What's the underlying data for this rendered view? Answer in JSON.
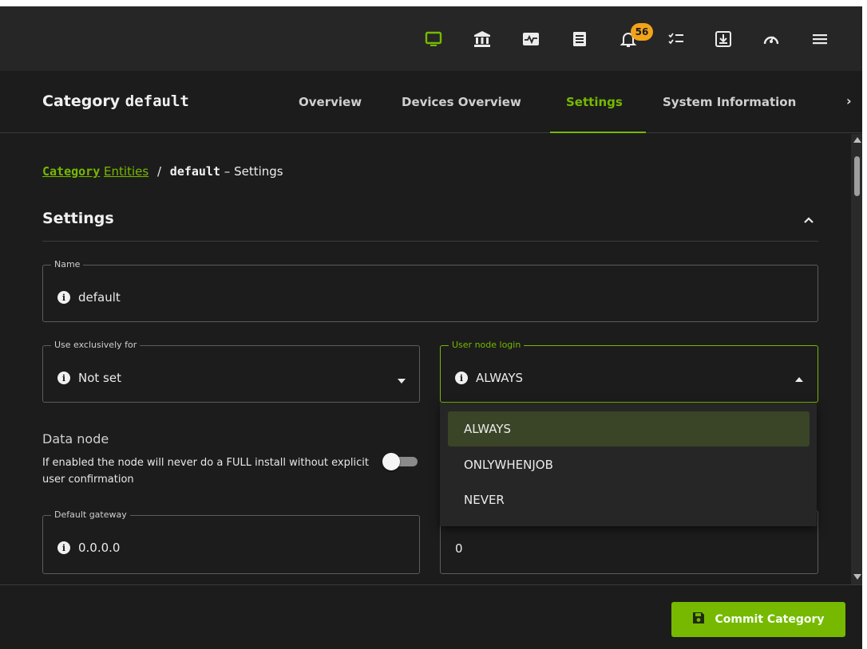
{
  "topbar": {
    "icons": [
      "monitor-icon",
      "bank-icon",
      "activity-icon",
      "document-icon",
      "bell-icon",
      "checklist-icon",
      "download-box-icon",
      "dashboard-icon",
      "menu-icon"
    ],
    "notification_count": "56",
    "accent": "#76b900",
    "badge_color": "#f2a31a"
  },
  "header": {
    "title_prefix": "Category",
    "title_name": "default",
    "tabs": [
      {
        "label": "Overview"
      },
      {
        "label": "Devices Overview"
      },
      {
        "label": "Settings"
      },
      {
        "label": "System Information"
      }
    ],
    "active_tab": "Settings"
  },
  "breadcrumb": {
    "category": "Category",
    "entities": "Entities",
    "separator": "/",
    "current": "default",
    "suffix": "– Settings"
  },
  "section": {
    "title": "Settings"
  },
  "fields": {
    "name": {
      "label": "Name",
      "value": "default"
    },
    "use_exclusively": {
      "label": "Use exclusively for",
      "value": "Not set"
    },
    "user_node_login": {
      "label": "User node login",
      "value": "ALWAYS"
    },
    "data_node": {
      "label": "Data node",
      "help": "If enabled the node will never do a FULL install without explicit user confirmation",
      "enabled": false
    },
    "default_gateway": {
      "label": "Default gateway",
      "value": "0.0.0.0"
    },
    "hidden_field": {
      "value": "0"
    }
  },
  "dropdown": {
    "options": [
      "ALWAYS",
      "ONLYWHENJOB",
      "NEVER"
    ],
    "selected": "ALWAYS"
  },
  "footer": {
    "commit_label": "Commit Category"
  }
}
